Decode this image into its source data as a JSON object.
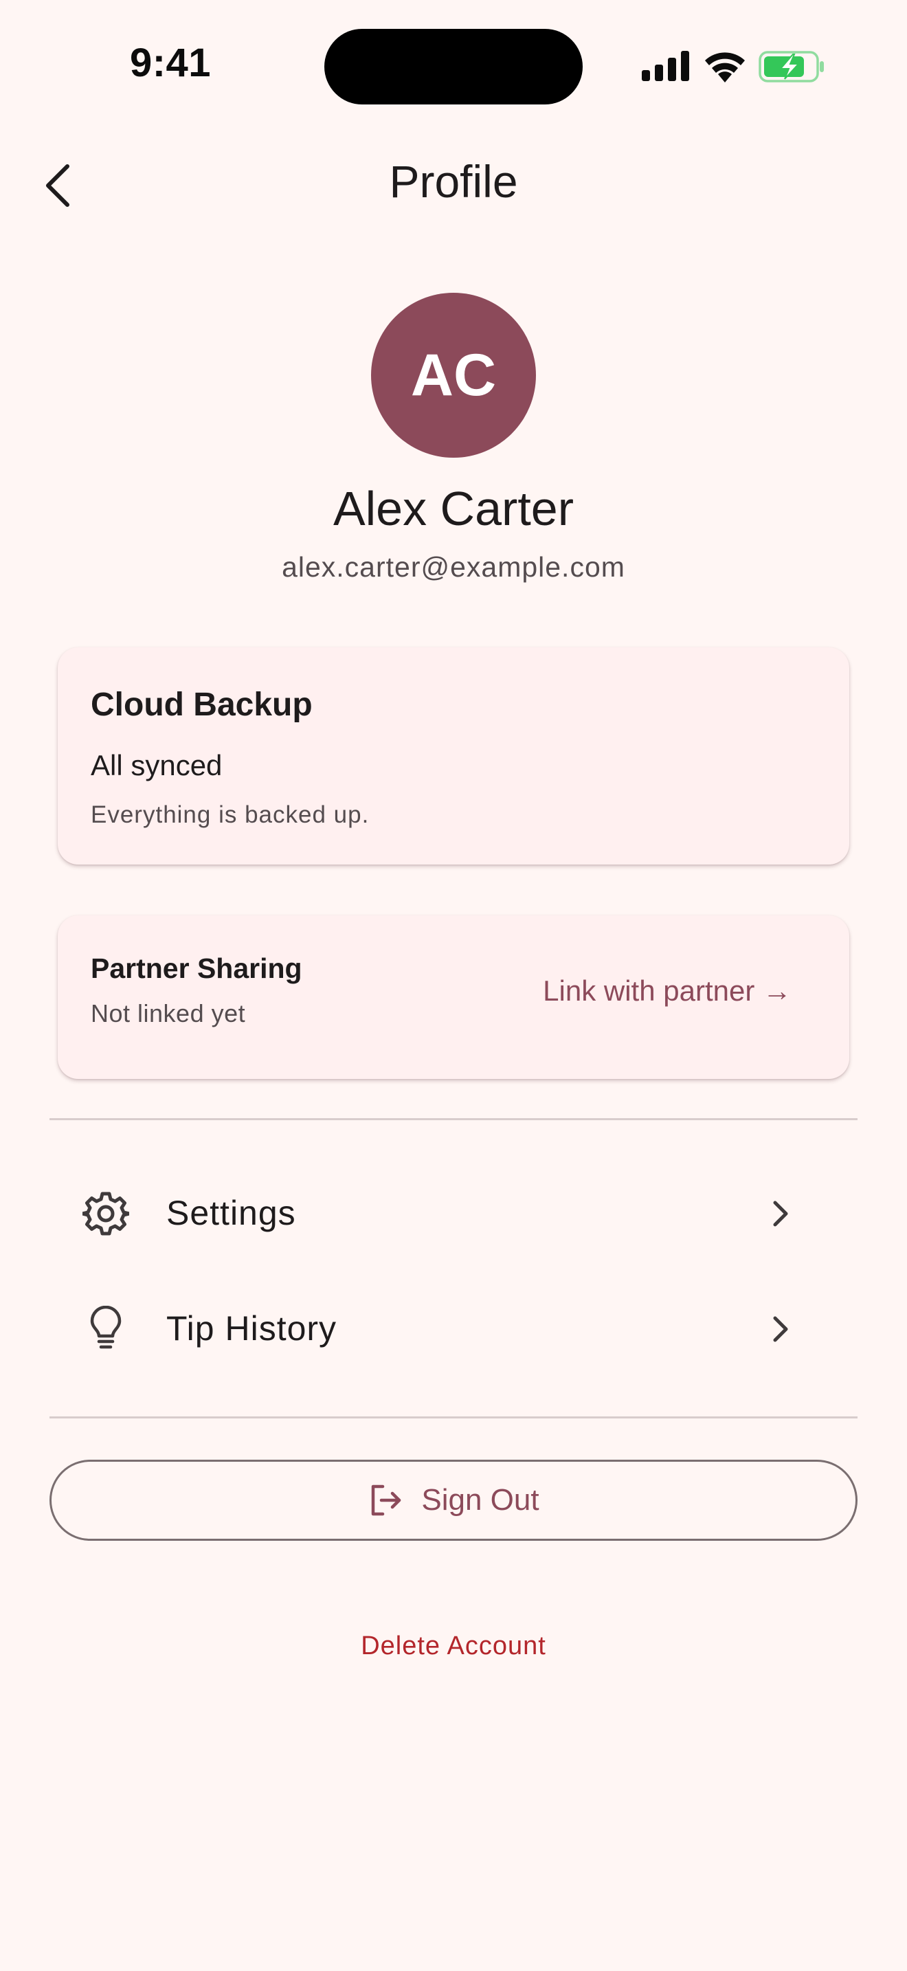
{
  "status_bar": {
    "time": "9:41",
    "icons": [
      "signal-icon",
      "wifi-icon",
      "battery-charging-icon"
    ]
  },
  "header": {
    "title": "Profile",
    "back_icon": "chevron-left-icon"
  },
  "profile": {
    "initials": "AC",
    "name": "Alex Carter",
    "email": "alex.carter@example.com"
  },
  "cloud_backup": {
    "title": "Cloud Backup",
    "status": "All synced",
    "description": "Everything is backed up."
  },
  "partner_sharing": {
    "title": "Partner Sharing",
    "status": "Not linked yet",
    "link_label": "Link with partner →"
  },
  "menu": {
    "items": [
      {
        "label": "Settings",
        "icon": "gear-icon"
      },
      {
        "label": "Tip History",
        "icon": "lightbulb-icon"
      }
    ]
  },
  "actions": {
    "sign_out_label": "Sign Out",
    "sign_out_icon": "sign-out-icon",
    "delete_label": "Delete Account"
  },
  "colors": {
    "background": "#FFF6F4",
    "card_background": "#FFF0F0",
    "accent": "#8C4A5A",
    "danger": "#B3262B",
    "battery_green": "#34C759"
  }
}
